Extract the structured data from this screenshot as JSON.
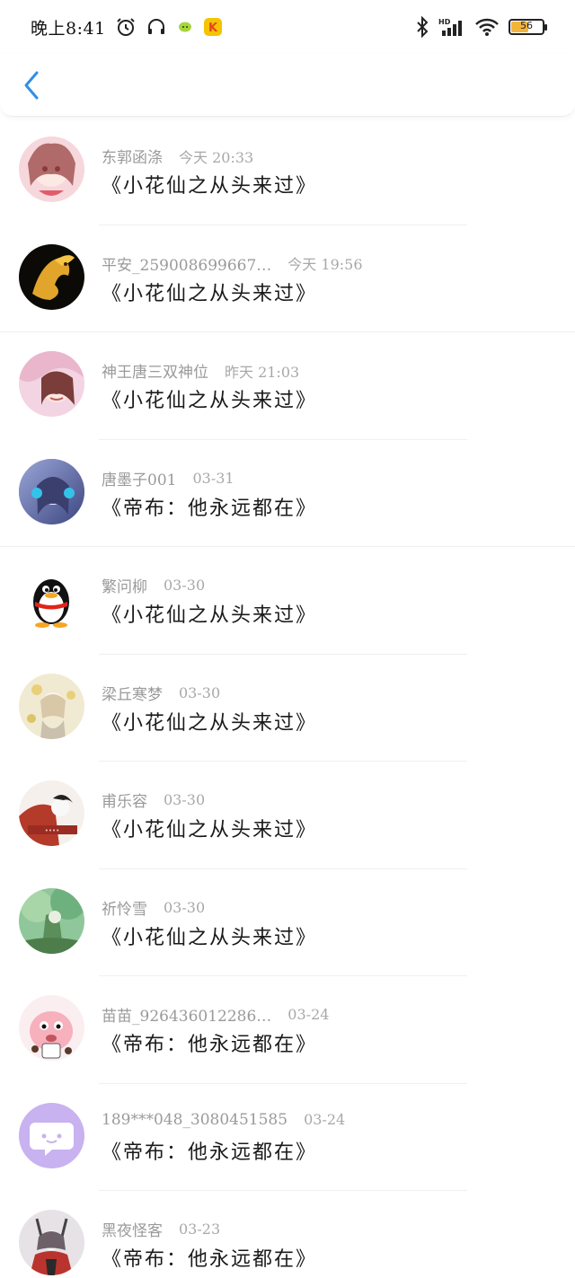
{
  "status": {
    "time": "晚上8:41",
    "battery_level": "56",
    "battery_fraction": 0.56,
    "network": "HD"
  },
  "nav": {
    "back_icon": "chevron-left-icon",
    "accent": "#2f8fe8"
  },
  "items": [
    {
      "name": "东郭函涤",
      "time": "今天 20:33",
      "title": "《小花仙之从头来过》",
      "avatar": "anime-girl-pink"
    },
    {
      "name": "平安_259008699667…",
      "time": "今天 19:56",
      "title": "《小花仙之从头来过》",
      "avatar": "golden-dragon"
    },
    {
      "name": "神王唐三双神位",
      "time": "昨天 21:03",
      "title": "《小花仙之从头来过》",
      "avatar": "anime-girl-blush"
    },
    {
      "name": "唐墨子001",
      "time": "03-31",
      "title": "《帝布：他永远都在》",
      "avatar": "anime-girl-headphones"
    },
    {
      "name": "繁问柳",
      "time": "03-30",
      "title": "《小花仙之从头来过》",
      "avatar": "qq-penguin"
    },
    {
      "name": "梁丘寒梦",
      "time": "03-30",
      "title": "《小花仙之从头来过》",
      "avatar": "anime-girl-leaves"
    },
    {
      "name": "甫乐容",
      "time": "03-30",
      "title": "《小花仙之从头来过》",
      "avatar": "anime-girl-red"
    },
    {
      "name": "祈怜雪",
      "time": "03-30",
      "title": "《小花仙之从头来过》",
      "avatar": "green-forest"
    },
    {
      "name": "苗苗_926436012286…",
      "time": "03-24",
      "title": "《帝布：他永远都在》",
      "avatar": "pink-cartoon"
    },
    {
      "name": "189***048_3080451585",
      "time": "03-24",
      "title": "《帝布：他永远都在》",
      "avatar": "purple-chat-bubble"
    },
    {
      "name": "黑夜怪客",
      "time": "03-23",
      "title": "《帝布：他永远都在》",
      "avatar": "anime-warrior"
    }
  ]
}
